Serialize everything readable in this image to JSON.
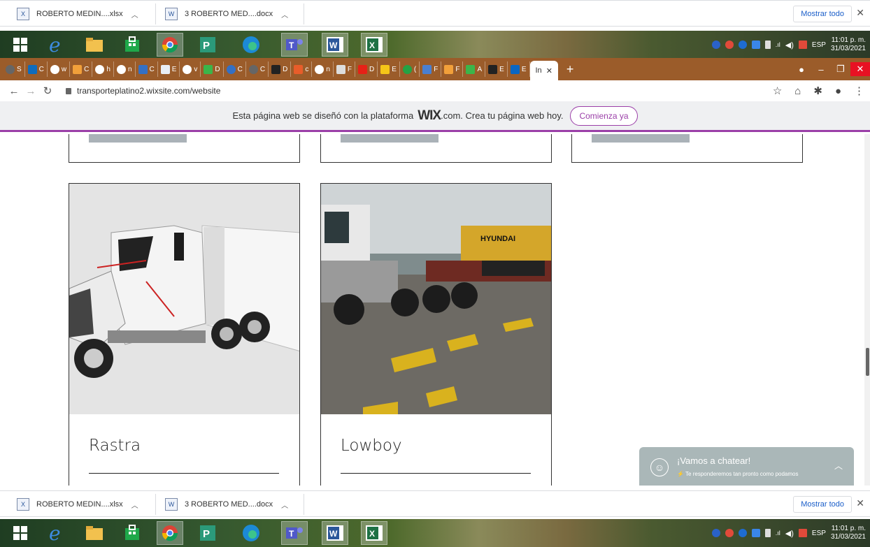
{
  "downloads": {
    "items": [
      {
        "icon": "excel-file-icon",
        "name": "ROBERTO MEDIN....xlsx"
      },
      {
        "icon": "word-file-icon",
        "name": "3 ROBERTO MED....docx"
      }
    ],
    "show_all": "Mostrar todo",
    "close": "✕"
  },
  "taskbar": {
    "lang": "ESP",
    "time": "11:01 p. m.",
    "date": "31/03/2021"
  },
  "tabs": {
    "active_tab_label": "In",
    "new_tab": "+"
  },
  "address": {
    "url": "transporteplatino2.wixsite.com/website"
  },
  "wix_banner": {
    "text_before": "Esta página web se diseñó con la plataforma",
    "logo": "WIX",
    "text_after": ".com. Crea tu página web hoy.",
    "cta": "Comienza ya"
  },
  "cards": [
    {
      "title": "Rastra",
      "image": "truck-trailer-photo"
    },
    {
      "title": "Lowboy",
      "image": "lowboy-excavator-photo"
    }
  ],
  "chat": {
    "title": "¡Vamos a chatear!",
    "subtitle": "Te responderemos tan pronto como podamos"
  },
  "colors": {
    "wix_accent": "#9b3fa8",
    "chrome_frame": "#9b5c2a",
    "chat_bg": "#aab7b8"
  }
}
